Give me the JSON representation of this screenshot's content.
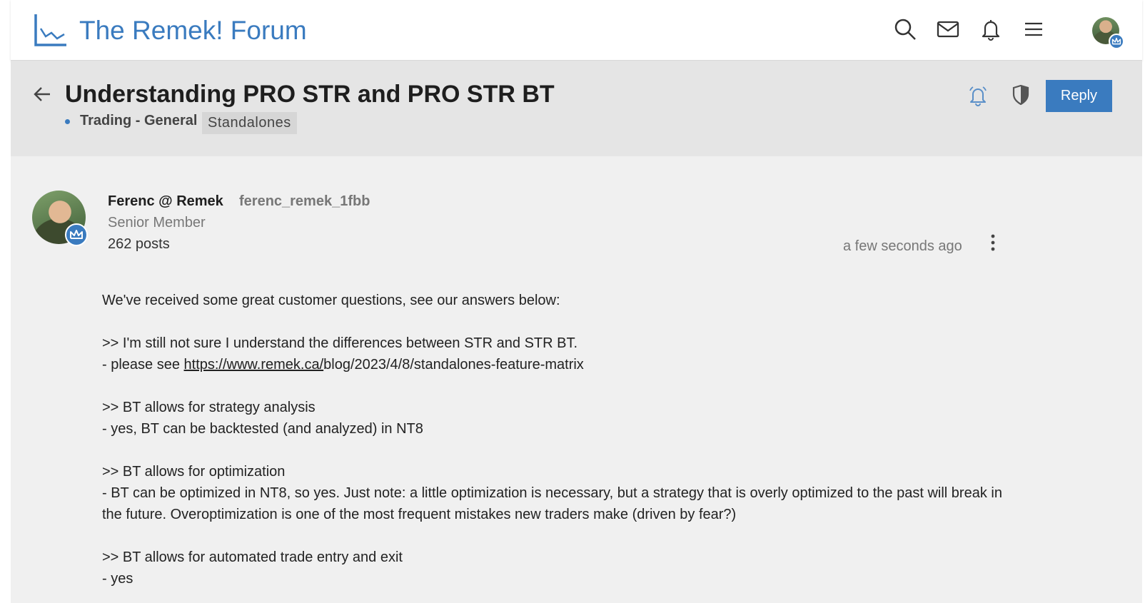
{
  "header": {
    "forum_title": "The Remek! Forum",
    "icons": [
      "chart-line-icon",
      "search-icon",
      "mail-icon",
      "bell-icon",
      "hamburger-menu-icon"
    ]
  },
  "topic": {
    "title": "Understanding PRO STR and PRO STR BT",
    "category": "Trading - General",
    "tag": "Standalones",
    "reply_label": "Reply"
  },
  "post": {
    "author_name": "Ferenc @ Remek",
    "author_handle": "ferenc_remek_1fbb",
    "author_role": "Senior Member",
    "author_posts": "262 posts",
    "timestamp": "a few seconds ago",
    "lines": {
      "intro": "We've received some great customer questions, see our answers below:",
      "q1": ">> I'm still not sure I understand the differences between STR and STR BT.",
      "a1_prefix": "- please see ",
      "a1_link": "https://www.remek.ca/",
      "a1_suffix": "blog/2023/4/8/standalones-feature-matrix",
      "q2": ">> BT allows for strategy analysis",
      "a2": "- yes, BT can be backtested (and analyzed) in NT8",
      "q3": ">> BT allows for optimization",
      "a3": "- BT can be optimized in NT8, so yes. Just note: a little optimization is necessary, but a strategy that is overly optimized to the past will break in the future. Overoptimization is one of the most frequent mistakes new traders make (driven by fear?)",
      "q4": ">> BT allows for automated trade entry and exit",
      "a4": "- yes"
    }
  },
  "colors": {
    "accent": "#3a7bbf",
    "page_bg": "#f0f0f0",
    "topic_bar_bg": "#e5e5e5"
  }
}
